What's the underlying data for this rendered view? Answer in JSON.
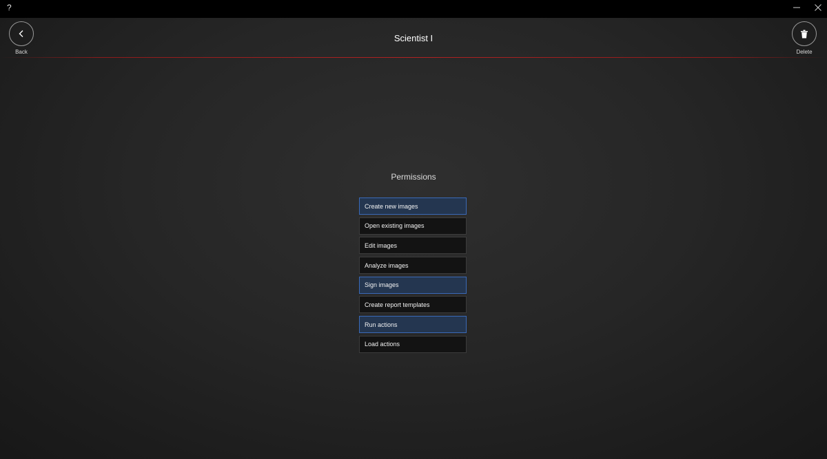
{
  "titlebar": {
    "help_glyph": "?",
    "minimize_icon": "minimize-icon",
    "close_icon": "close-icon"
  },
  "header": {
    "back_label": "Back",
    "title": "Scientist I",
    "delete_label": "Delete"
  },
  "permissions": {
    "title": "Permissions",
    "items": [
      {
        "label": "Create new images",
        "selected": true
      },
      {
        "label": "Open existing images",
        "selected": false
      },
      {
        "label": "Edit images",
        "selected": false
      },
      {
        "label": "Analyze images",
        "selected": false
      },
      {
        "label": "Sign images",
        "selected": true
      },
      {
        "label": "Create report templates",
        "selected": false
      },
      {
        "label": "Run actions",
        "selected": true
      },
      {
        "label": "Load actions",
        "selected": false
      }
    ]
  },
  "colors": {
    "accent_red": "#b22222",
    "selected_bg": "#243650",
    "selected_border": "#3a6ab8",
    "item_bg": "#131313"
  }
}
